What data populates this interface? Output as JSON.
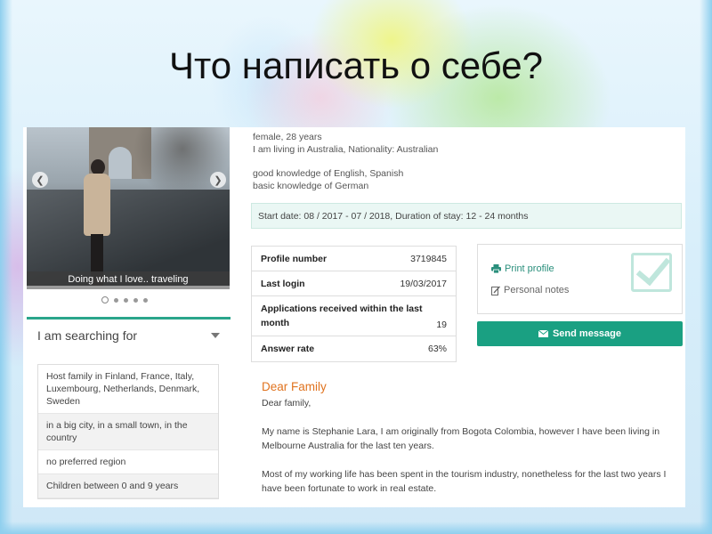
{
  "slide": {
    "title": "Что написать о себе?"
  },
  "photo": {
    "caption": "Doing what I love.. traveling",
    "prev_icon": "chevron-left-icon",
    "next_icon": "chevron-right-icon",
    "dot_count": 5,
    "active_dot": 0
  },
  "search": {
    "header": "I am searching for",
    "items": [
      "Host family in Finland, France, Italy, Luxembourg, Netherlands, Denmark, Sweden",
      "in a big city, in a small town, in the country",
      "no preferred region",
      "Children between 0 and 9 years"
    ]
  },
  "profile": {
    "line1": "female, 28 years",
    "line2": "I am living in Australia, Nationality: Australian",
    "lang1": "good knowledge of English, Spanish",
    "lang2": "basic knowledge of German",
    "stay": "Start date: 08 / 2017 - 07 / 2018, Duration of stay: 12 - 24 months"
  },
  "stats": [
    {
      "label": "Profile number",
      "value": "3719845"
    },
    {
      "label": "Last login",
      "value": "19/03/2017"
    },
    {
      "label": "Applications received within the last month",
      "value": "19"
    },
    {
      "label": "Answer rate",
      "value": "63%"
    }
  ],
  "actions": {
    "print_label": "Print profile",
    "notes_label": "Personal notes",
    "send_label": "Send message"
  },
  "letter": {
    "heading": "Dear Family",
    "salutation": "Dear family,",
    "p1": "My name is Stephanie Lara, I am originally from Bogota Colombia, however I have been living in Melbourne Australia for the last ten years.",
    "p2": "Most of my working life has been spent in the tourism industry, nonetheless for the last two years I have been fortunate to work in real estate."
  },
  "colors": {
    "accent": "#1aa082",
    "heading": "#e0731f"
  }
}
